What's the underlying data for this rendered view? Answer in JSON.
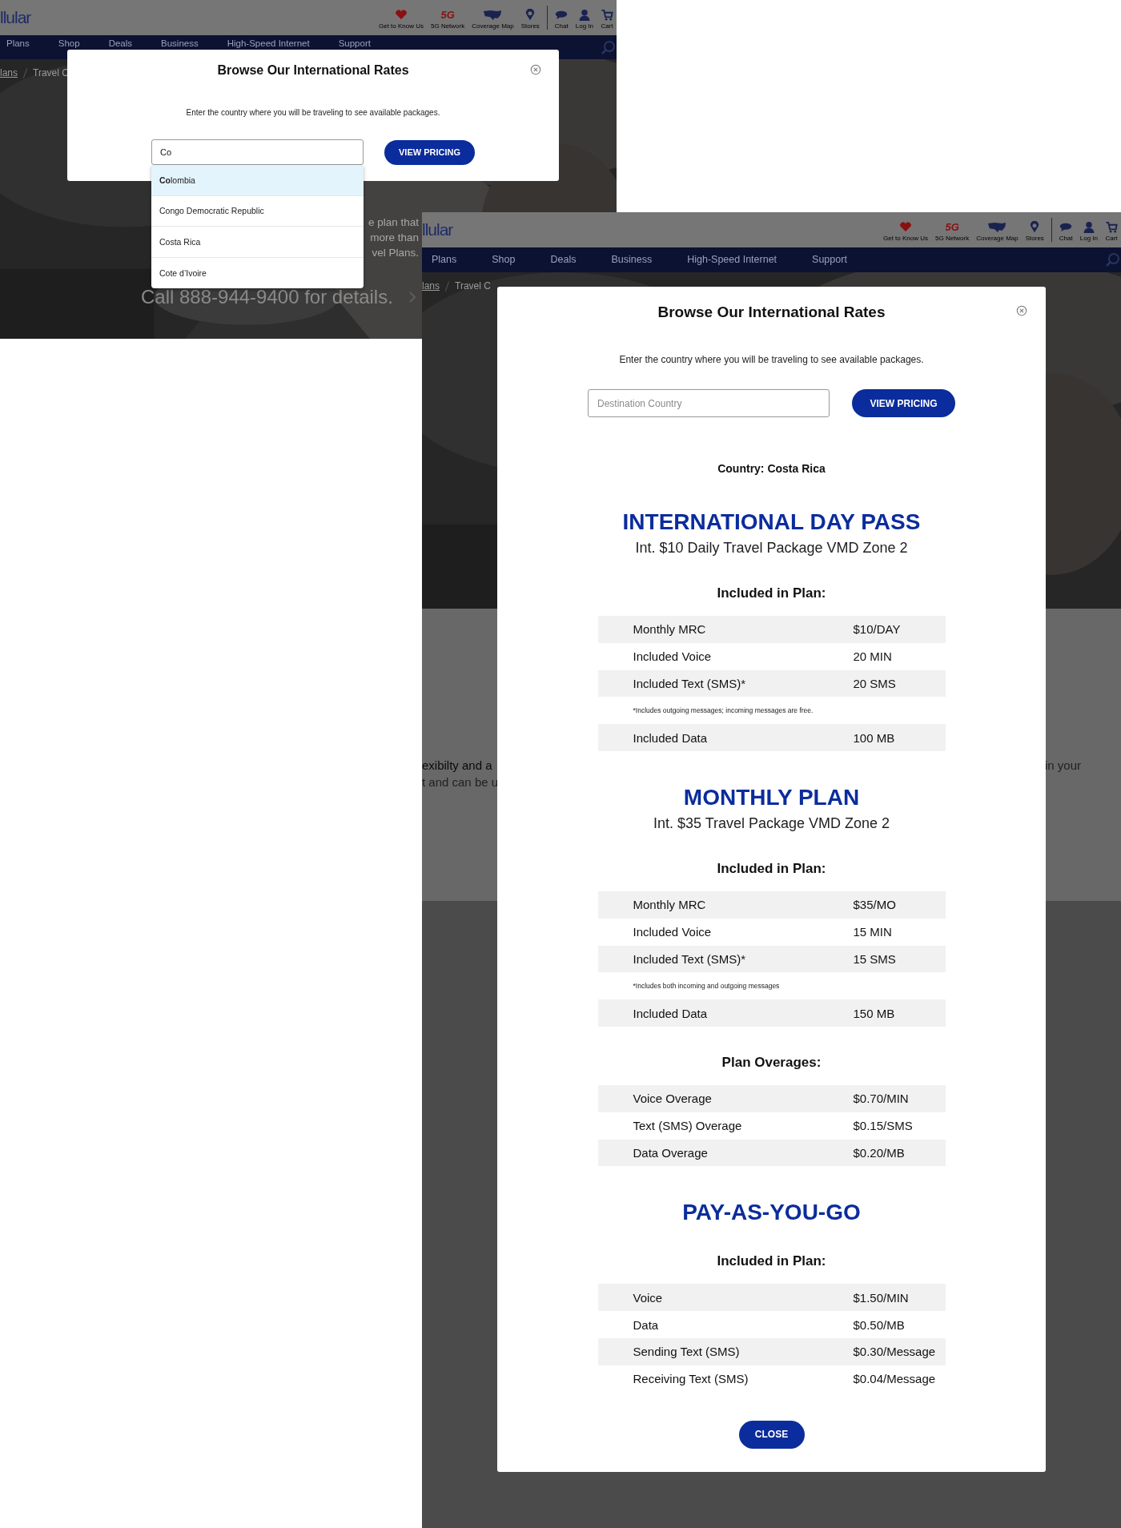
{
  "screens": [
    {
      "logo": "llular",
      "header_links": [
        {
          "label": "Get to Know Us",
          "kind": "heart"
        },
        {
          "label": "5G Network",
          "kind": "fiveg",
          "icon_text": "5G"
        },
        {
          "label": "Coverage Map",
          "kind": "map"
        },
        {
          "label": "Stores",
          "kind": "pin"
        },
        {
          "label": "Chat",
          "kind": "chat"
        },
        {
          "label": "Log In",
          "kind": "user"
        },
        {
          "label": "Cart",
          "kind": "cart"
        }
      ],
      "nav": [
        "Plans",
        "Shop",
        "Deals",
        "Business",
        "High-Speed Internet",
        "Support"
      ],
      "breadcrumb": [
        "lans",
        "Travel C"
      ],
      "hero_texts": [
        "e plan that",
        "more than",
        "vel Plans."
      ],
      "hero_link": "Call 888-944-9400 for details.",
      "modal": {
        "title": "Browse Our International Rates",
        "subtitle": "Enter the country where you will be traveling to see available packages.",
        "search": {
          "value": "Co"
        },
        "button": "VIEW PRICING",
        "suggestions": [
          {
            "text": "**Co**lombia",
            "selected": true
          },
          {
            "text": "Congo Democratic Republic",
            "selected": false
          },
          {
            "text": "Costa Rica",
            "selected": false
          },
          {
            "text": "Cote d’Ivoire",
            "selected": false
          }
        ]
      }
    },
    {
      "logo": "llular",
      "header_links": [
        {
          "label": "Get to Know Us",
          "kind": "heart"
        },
        {
          "label": "5G Network",
          "kind": "fiveg",
          "icon_text": "5G"
        },
        {
          "label": "Coverage Map",
          "kind": "map"
        },
        {
          "label": "Stores",
          "kind": "pin"
        },
        {
          "label": "Chat",
          "kind": "chat"
        },
        {
          "label": "Log In",
          "kind": "user"
        },
        {
          "label": "Cart",
          "kind": "cart"
        }
      ],
      "nav": [
        "Plans",
        "Shop",
        "Deals",
        "Business",
        "High-Speed Internet",
        "Support"
      ],
      "breadcrumb": [
        "lans",
        "Travel C"
      ],
      "page_texts": [
        {
          "text": "exibilty and a",
          "kind": "strong"
        },
        {
          "text": "t and can be u",
          "kind": "plain"
        },
        {
          "text": "in your",
          "kind": "right"
        }
      ],
      "modal": {
        "title": "Browse Our International Rates",
        "subtitle": "Enter the country where you will be traveling to see available packages.",
        "search": {
          "placeholder": "Destination Country"
        },
        "button": "VIEW PRICING",
        "country": "Country: Costa Rica",
        "sections": [
          {
            "title": "INTERNATIONAL DAY PASS",
            "subtitle": "Int. $10 Daily Travel Package VMD Zone 2",
            "groups": [
              {
                "heading": "Included in Plan:",
                "rows": [
                  {
                    "kind": "item",
                    "label": "Monthly MRC",
                    "value": "$10/DAY"
                  },
                  {
                    "kind": "item",
                    "label": "Included Voice",
                    "value": "20 MIN"
                  },
                  {
                    "kind": "item",
                    "label": "Included Text (SMS)*",
                    "value": "20 SMS"
                  },
                  {
                    "kind": "note",
                    "text": "*Includes outgoing messages; incoming messages are free."
                  },
                  {
                    "kind": "item",
                    "label": "Included Data",
                    "value": "100 MB"
                  }
                ]
              }
            ]
          },
          {
            "title": "MONTHLY PLAN",
            "subtitle": "Int. $35 Travel Package VMD Zone 2",
            "groups": [
              {
                "heading": "Included in Plan:",
                "rows": [
                  {
                    "kind": "item",
                    "label": "Monthly MRC",
                    "value": "$35/MO"
                  },
                  {
                    "kind": "item",
                    "label": "Included Voice",
                    "value": "15 MIN"
                  },
                  {
                    "kind": "item",
                    "label": "Included Text (SMS)*",
                    "value": "15 SMS"
                  },
                  {
                    "kind": "note",
                    "text": "*Includes both incoming and outgoing messages"
                  },
                  {
                    "kind": "item",
                    "label": "Included Data",
                    "value": "150 MB"
                  }
                ]
              },
              {
                "heading": "Plan Overages:",
                "rows": [
                  {
                    "kind": "item",
                    "label": "Voice Overage",
                    "value": "$0.70/MIN"
                  },
                  {
                    "kind": "item",
                    "label": "Text (SMS) Overage",
                    "value": "$0.15/SMS"
                  },
                  {
                    "kind": "item",
                    "label": "Data Overage",
                    "value": "$0.20/MB"
                  }
                ]
              }
            ]
          },
          {
            "title": "PAY-AS-YOU-GO",
            "groups": [
              {
                "heading": "Included in Plan:",
                "rows": [
                  {
                    "kind": "item",
                    "label": "Voice",
                    "value": "$1.50/MIN"
                  },
                  {
                    "kind": "item",
                    "label": "Data",
                    "value": "$0.50/MB"
                  },
                  {
                    "kind": "item",
                    "label": "Sending Text (SMS)",
                    "value": "$0.30/Message"
                  },
                  {
                    "kind": "item",
                    "label": "Receiving Text (SMS)",
                    "value": "$0.04/Message"
                  }
                ]
              }
            ]
          }
        ],
        "close": "CLOSE"
      }
    }
  ]
}
